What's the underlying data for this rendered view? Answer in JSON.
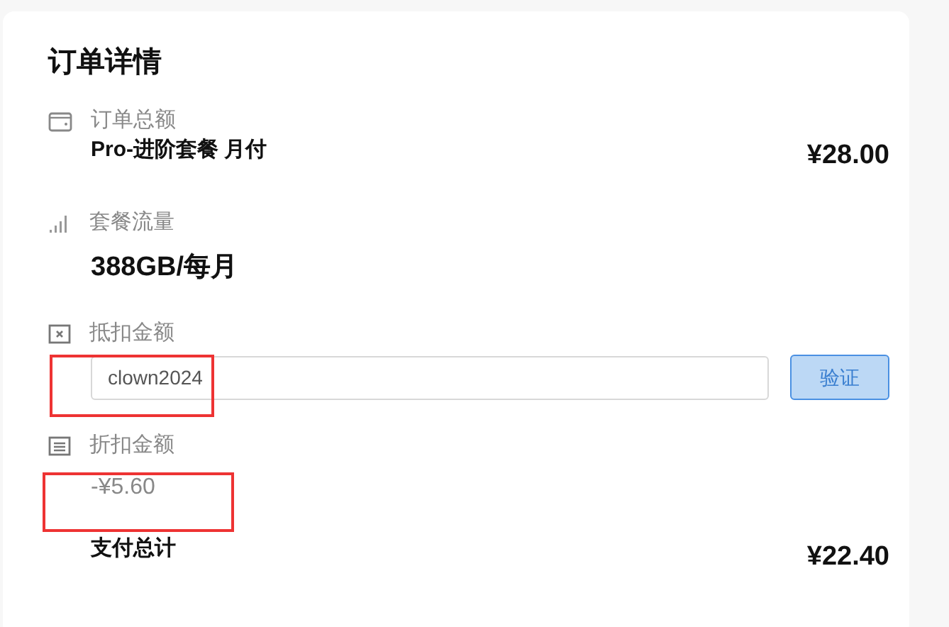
{
  "title": "订单详情",
  "order_total": {
    "label": "订单总额",
    "item": "Pro-进阶套餐 月付",
    "price": "¥28.00"
  },
  "traffic": {
    "label": "套餐流量",
    "value": "388GB/每月"
  },
  "deduction": {
    "label": "抵扣金额",
    "input_value": "clown2024",
    "button": "验证"
  },
  "discount": {
    "label": "折扣金额",
    "value": "-¥5.60"
  },
  "total": {
    "label": "支付总计",
    "price": "¥22.40"
  }
}
